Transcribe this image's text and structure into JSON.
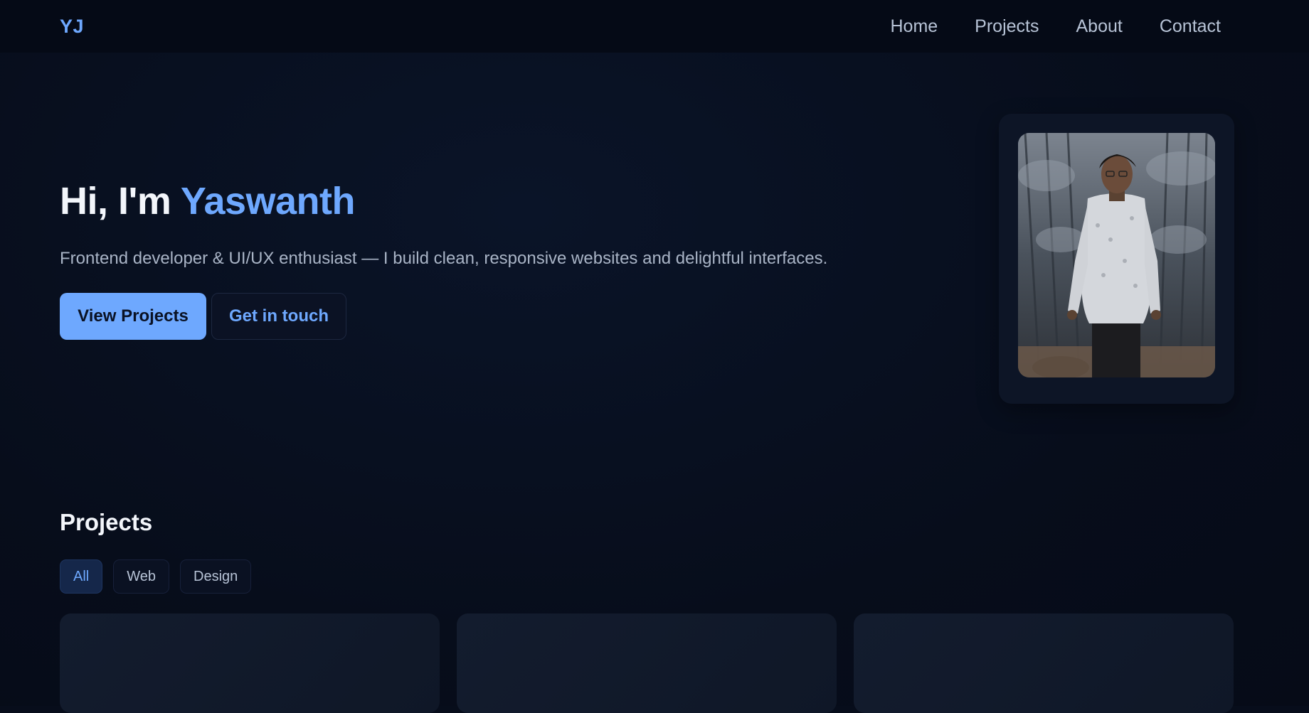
{
  "nav": {
    "logo": "YJ",
    "links": [
      "Home",
      "Projects",
      "About",
      "Contact"
    ]
  },
  "hero": {
    "greeting": "Hi, I'm ",
    "name": "Yaswanth",
    "subtitle": "Frontend developer & UI/UX enthusiast — I build clean, responsive websites and delightful interfaces.",
    "primary_button": "View Projects",
    "secondary_button": "Get in touch"
  },
  "projects": {
    "title": "Projects",
    "filters": [
      "All",
      "Web",
      "Design"
    ],
    "active_filter": "All",
    "cards": [
      {},
      {},
      {}
    ]
  },
  "colors": {
    "accent": "#6ea8fe",
    "background": "#070d1b"
  }
}
